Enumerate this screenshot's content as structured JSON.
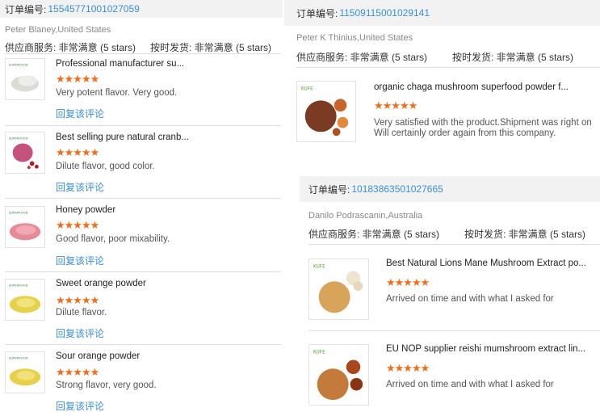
{
  "left": {
    "order_label": "订单编号:",
    "order_number": "15545771001027059",
    "buyer": "Peter Blaney,United States",
    "service_rating": "供应商服务: 非常满意 (5 stars)",
    "shipping_rating": "按时发货: 非常满意 (5 stars)",
    "items": [
      {
        "title": "Professional manufacturer su...",
        "stars": "★★★★★",
        "comment": "Very potent flavor. Very good.",
        "reply": "回复该评论",
        "thumb_color": "#e8e8e4"
      },
      {
        "title": "Best selling pure natural cranb...",
        "stars": "★★★★★",
        "comment": "Dilute flavor, good color.",
        "reply": "回复该评论",
        "thumb_color": "#c4527c"
      },
      {
        "title": "Honey powder",
        "stars": "★★★★★",
        "comment": "Good flavor, poor mixability.",
        "reply": "回复该评论",
        "thumb_color": "#e58a96"
      },
      {
        "title": "Sweet orange powder",
        "stars": "★★★★★",
        "comment": "Dilute flavor.",
        "reply": "回复该评论",
        "thumb_color": "#e6d24a"
      },
      {
        "title": "Sour orange powder",
        "stars": "★★★★★",
        "comment": "Strong flavor, very good.",
        "reply": "回复该评论",
        "thumb_color": "#e7d04a"
      }
    ]
  },
  "top_right": {
    "order_label": "订单编号:",
    "order_number": "11509115001029141",
    "buyer": "Peter K Thinius,United States",
    "service_rating": "供应商服务: 非常满意 (5 stars)",
    "shipping_rating": "按时发货: 非常满意 (5 stars)",
    "item": {
      "title": "organic chaga mushroom superfood powder f...",
      "stars": "★★★★★",
      "comment_line1": "Very satisfied with the product.Shipment was right on",
      "comment_line2": "Will certainly order again from this company.",
      "thumb_color": "#7a3a24"
    }
  },
  "bottom_right": {
    "order_label": "订单编号:",
    "order_number": "10183863501027665",
    "buyer": "Danilo Podrascanin,Australia",
    "service_rating": "供应商服务: 非常满意 (5 stars)",
    "shipping_rating": "按时发货: 非常满意 (5 stars)",
    "items": [
      {
        "title": "Best Natural Lions Mane Mushroom Extract po...",
        "stars": "★★★★★",
        "comment": "Arrived on time and with what I asked for",
        "thumb_color": "#d8a45a"
      },
      {
        "title": "EU NOP supplier reishi mumshroom extract lin...",
        "stars": "★★★★★",
        "comment": "Arrived on time and with what I asked for",
        "thumb_color": "#c47a3a"
      }
    ]
  },
  "colors": {
    "accent": "#3a8fd6",
    "stars": "#f26d1a",
    "bar": "#f2f2f2"
  }
}
